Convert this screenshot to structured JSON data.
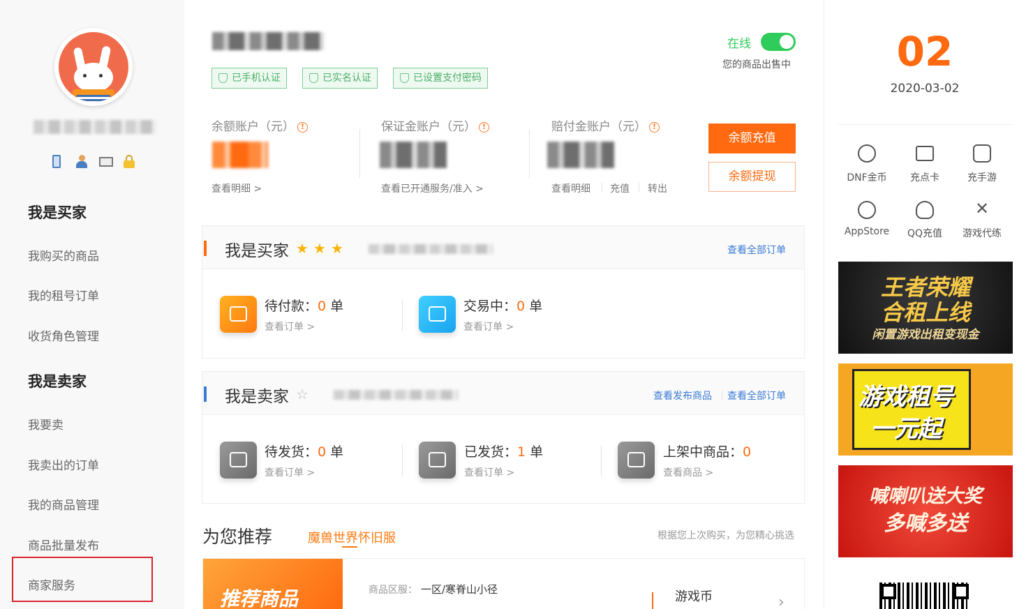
{
  "sidebar": {
    "icons": [
      "phone-icon",
      "user-icon",
      "mail-icon",
      "lock-icon"
    ],
    "buyer_heading": "我是买家",
    "buyer_items": [
      "我购买的商品",
      "我的租号订单",
      "收货角色管理"
    ],
    "seller_heading": "我是卖家",
    "seller_items": [
      "我要卖",
      "我卖出的订单",
      "我的商品管理",
      "商品批量发布",
      "商家服务"
    ]
  },
  "profile": {
    "status_label": "在线",
    "status_on": true,
    "status_desc": "您的商品出售中",
    "tags": [
      "已手机认证",
      "已实名认证",
      "已设置支付密码"
    ]
  },
  "accounts": {
    "balance": {
      "title": "余额账户（元）",
      "info": "!",
      "link": "查看明细 >"
    },
    "deposit": {
      "title": "保证金账户（元）",
      "info": "!",
      "link": "查看已开通服务/准入 >"
    },
    "compensation": {
      "title": "赔付金账户（元）",
      "info": "!",
      "links": [
        "查看明细",
        "充值",
        "转出"
      ]
    },
    "recharge_button": "余额充值",
    "withdraw_button": "余额提现"
  },
  "buyer_panel": {
    "title": "我是买家",
    "stars": "★",
    "view_all": "查看全部订单",
    "stats": [
      {
        "label": "待付款：",
        "count": "0",
        "unit": " 单",
        "link": "查看订单 >"
      },
      {
        "label": "交易中：",
        "count": "0",
        "unit": " 单",
        "link": "查看订单 >"
      }
    ]
  },
  "seller_panel": {
    "title": "我是卖家",
    "star": "☆",
    "view_published": "查看发布商品",
    "view_all": "查看全部订单",
    "stats": [
      {
        "label": "待发货：",
        "count": "0",
        "unit": " 单",
        "link": "查看订单 >"
      },
      {
        "label": "已发货：",
        "count": "1",
        "unit": " 单",
        "link": "查看订单 >"
      },
      {
        "label": "上架中商品：",
        "count": "0",
        "unit": "",
        "link": "查看商品 >"
      }
    ]
  },
  "recommend": {
    "title": "为您推荐",
    "tab": "魔兽世界怀旧服",
    "hint": "根据您上次购买，为您精心挑选",
    "card_label": "推荐商品",
    "server_label": "商品区服：",
    "server_value": "一区/寒脊山小径",
    "type": "游戏币",
    "chevron": "›"
  },
  "calendar": {
    "day": "02",
    "date": "2020-03-02"
  },
  "quick_links": [
    {
      "label": "DNF金币",
      "icon": "dnf-gold-icon"
    },
    {
      "label": "充点卡",
      "icon": "card-icon"
    },
    {
      "label": "充手游",
      "icon": "mobile-game-icon"
    },
    {
      "label": "AppStore",
      "icon": "appstore-icon"
    },
    {
      "label": "QQ充值",
      "icon": "qq-icon"
    },
    {
      "label": "游戏代练",
      "icon": "swords-icon"
    }
  ],
  "banners": [
    {
      "line1": "王者荣耀",
      "line2": "合租上线",
      "line3": "闲置游戏出租变现金"
    },
    {
      "line1": "游戏租号",
      "line2": "一元起"
    },
    {
      "line1": "喊喇叭送大奖",
      "line2": "多喊多送"
    }
  ],
  "colors": {
    "accent": "#ff6a10",
    "green": "#2ecc5a",
    "blue": "#3a7bd5",
    "text_gray": "#999999"
  }
}
